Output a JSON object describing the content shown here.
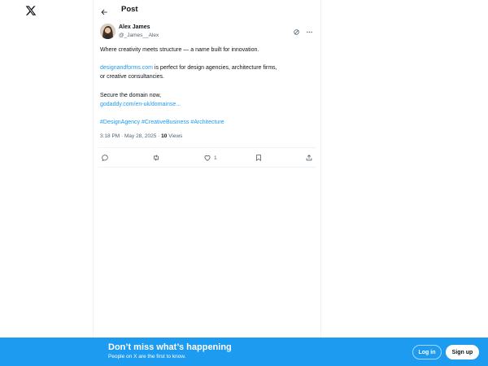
{
  "header": {
    "title": "Post"
  },
  "post": {
    "author": {
      "name": "Alex James",
      "handle": "@_James__Alex"
    },
    "lines": [
      {
        "text": "Where creativity meets structure — a name built for innovation."
      },
      {
        "link": "designandforms.com",
        "text": " is perfect for design agencies, architecture firms,"
      },
      {
        "text": "or creative consultancies."
      },
      {
        "text": "Secure the domain now,"
      },
      {
        "link": "godaddy.com/en-uk/domainse..."
      },
      {
        "hashtags": [
          "#DesignAgency",
          "#CreativeBusiness",
          "#Architecture"
        ]
      }
    ],
    "meta": {
      "time": "3:18 PM · May 28, 2025 · ",
      "views_count": "10",
      "views_label": " Views"
    },
    "actions": {
      "like_count": "1"
    }
  },
  "icons": {
    "logo": "x-logo-icon",
    "back": "arrow-left-icon",
    "grok": "grok-icon",
    "more": "more-icon",
    "reply": "reply-icon",
    "repost": "repost-icon",
    "like": "heart-icon",
    "bookmark": "bookmark-icon",
    "share": "share-icon"
  },
  "banner": {
    "title": "Don’t miss what’s happening",
    "subtitle": "People on X are the first to know.",
    "login_label": "Log in",
    "signup_label": "Sign up"
  },
  "colors": {
    "accent": "#1d9bf0",
    "text": "#0f1419",
    "muted": "#536471"
  }
}
